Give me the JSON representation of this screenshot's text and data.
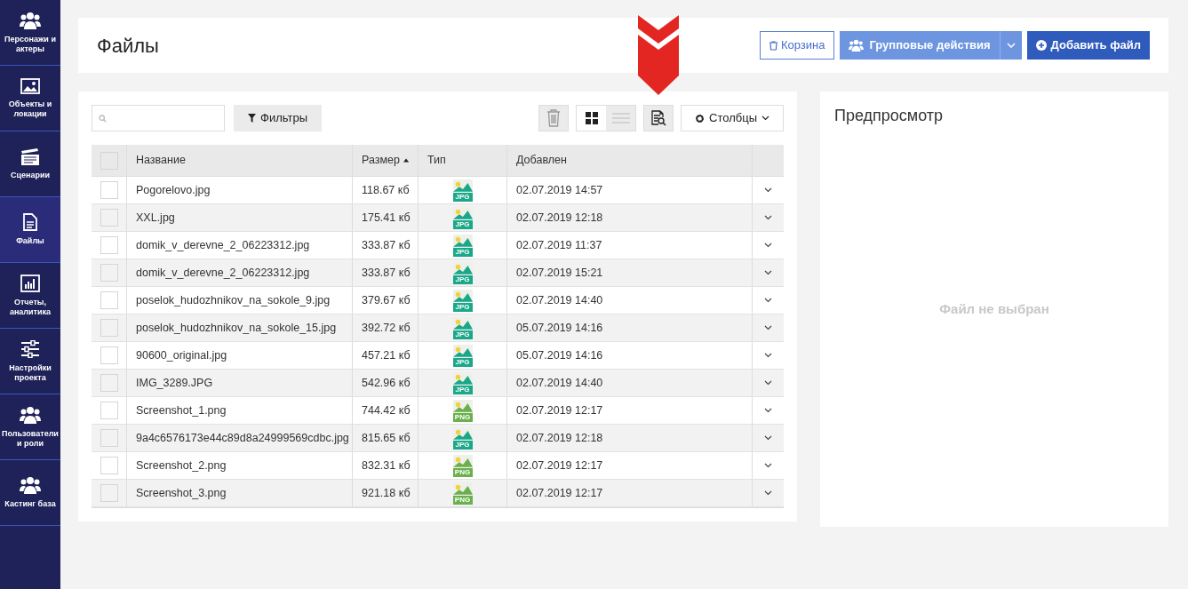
{
  "sidebar": {
    "items": [
      {
        "label": "Персонажи и актеры",
        "selected": false
      },
      {
        "label": "Объекты и локации",
        "selected": false
      },
      {
        "label": "Сценарии",
        "selected": false
      },
      {
        "label": "Файлы",
        "selected": true
      },
      {
        "label": "Отчеты, аналитика",
        "selected": false
      },
      {
        "label": "Настройки проекта",
        "selected": false
      },
      {
        "label": "Пользователи и роли",
        "selected": false
      },
      {
        "label": "Кастинг база",
        "selected": false
      }
    ]
  },
  "header": {
    "title": "Файлы",
    "trash_button": "Корзина",
    "group_actions_button": "Групповые действия",
    "add_button": "Добавить файл"
  },
  "toolbar": {
    "filters_button": "Фильтры",
    "view_modes": [
      {
        "kind": "grid",
        "selected": true
      },
      {
        "kind": "list",
        "selected": false
      }
    ],
    "columns_button": "Столбцы"
  },
  "table": {
    "select_all_checked": false,
    "columns": [
      {
        "label": "Название",
        "sorted": false
      },
      {
        "label": "Размер",
        "sorted": true
      },
      {
        "label": "Тип",
        "sorted": false
      },
      {
        "label": "Добавлен",
        "sorted": false
      }
    ],
    "rows": [
      {
        "name": "Pogorelovo.jpg",
        "size": "118.67 кб",
        "type": "JPG",
        "added": "02.07.2019 14:57",
        "checked": false
      },
      {
        "name": "XXL.jpg",
        "size": "175.41 кб",
        "type": "JPG",
        "added": "02.07.2019 12:18",
        "checked": false
      },
      {
        "name": "domik_v_derevne_2_06223312.jpg",
        "size": "333.87 кб",
        "type": "JPG",
        "added": "02.07.2019 11:37",
        "checked": false
      },
      {
        "name": "domik_v_derevne_2_06223312.jpg",
        "size": "333.87 кб",
        "type": "JPG",
        "added": "02.07.2019 15:21",
        "checked": false
      },
      {
        "name": "poselok_hudozhnikov_na_sokole_9.jpg",
        "size": "379.67 кб",
        "type": "JPG",
        "added": "02.07.2019 14:40",
        "checked": false
      },
      {
        "name": "poselok_hudozhnikov_na_sokole_15.jpg",
        "size": "392.72 кб",
        "type": "JPG",
        "added": "05.07.2019 14:16",
        "checked": false
      },
      {
        "name": "90600_original.jpg",
        "size": "457.21 кб",
        "type": "JPG",
        "added": "05.07.2019 14:16",
        "checked": false
      },
      {
        "name": "IMG_3289.JPG",
        "size": "542.96 кб",
        "type": "JPG",
        "added": "02.07.2019 14:40",
        "checked": false
      },
      {
        "name": "Screenshot_1.png",
        "size": "744.42 кб",
        "type": "PNG",
        "added": "02.07.2019 12:17",
        "checked": false
      },
      {
        "name": "9a4c6576173e44c89d8a24999569cdbc.jpg",
        "size": "815.65 кб",
        "type": "JPG",
        "added": "02.07.2019 12:18",
        "checked": false
      },
      {
        "name": "Screenshot_2.png",
        "size": "832.31 кб",
        "type": "PNG",
        "added": "02.07.2019 12:17",
        "checked": false
      },
      {
        "name": "Screenshot_3.png",
        "size": "921.18 кб",
        "type": "PNG",
        "added": "02.07.2019 12:17",
        "checked": false
      }
    ]
  },
  "preview": {
    "title": "Предпросмотр",
    "empty_text": "Файл не выбран"
  }
}
